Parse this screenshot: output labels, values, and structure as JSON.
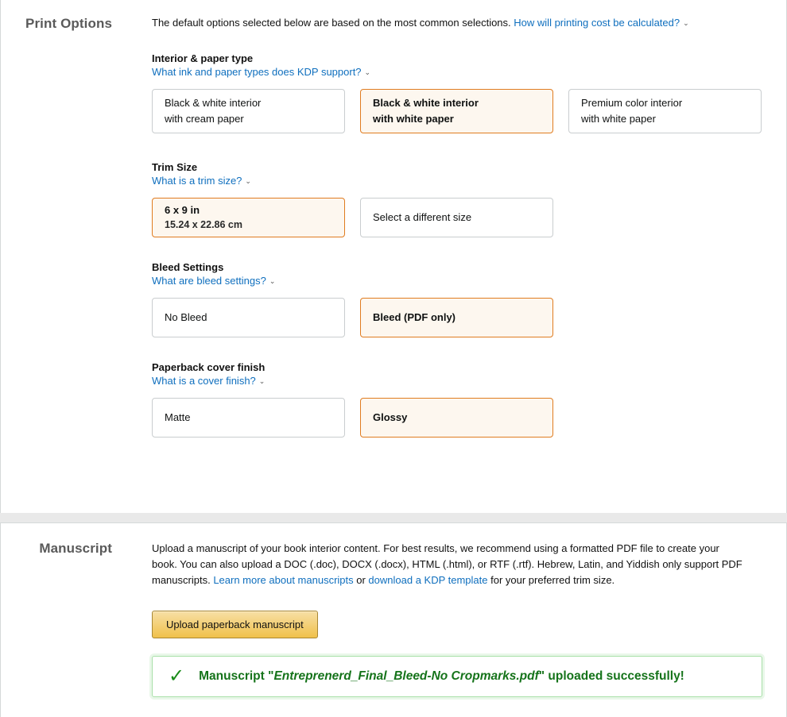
{
  "print_options": {
    "section_title": "Print Options",
    "intro_text": "The default options selected below are based on the most common selections.",
    "intro_link": "How will printing cost be calculated?",
    "groups": [
      {
        "label": "Interior & paper type",
        "help_link": "What ink and paper types does KDP support?",
        "options": [
          {
            "line1": "Black & white interior",
            "line2": "with cream paper",
            "selected": false
          },
          {
            "line1": "Black & white interior",
            "line2": "with white paper",
            "selected": true
          },
          {
            "line1": "Premium color interior",
            "line2": "with white paper",
            "selected": false
          }
        ]
      },
      {
        "label": "Trim Size",
        "help_link": "What is a trim size?",
        "options": [
          {
            "line1": "6 x 9 in",
            "line2": "15.24 x 22.86 cm",
            "selected": true
          },
          {
            "line1": "Select a different size",
            "line2": "",
            "selected": false
          }
        ]
      },
      {
        "label": "Bleed Settings",
        "help_link": "What are bleed settings?",
        "options": [
          {
            "line1": "No Bleed",
            "line2": "",
            "selected": false
          },
          {
            "line1": "Bleed (PDF only)",
            "line2": "",
            "selected": true
          }
        ]
      },
      {
        "label": "Paperback cover finish",
        "help_link": "What is a cover finish?",
        "options": [
          {
            "line1": "Matte",
            "line2": "",
            "selected": false
          },
          {
            "line1": "Glossy",
            "line2": "",
            "selected": true
          }
        ]
      }
    ]
  },
  "manuscript": {
    "section_title": "Manuscript",
    "desc_part1": "Upload a manuscript of your book interior content. For best results, we recommend using a formatted PDF file to create your book. You can also upload a DOC (.doc), DOCX (.docx), HTML (.html), or RTF (.rtf). Hebrew, Latin, and Yiddish only support PDF manuscripts. ",
    "link1": "Learn more about manuscripts",
    "desc_mid": " or ",
    "link2": "download a KDP template",
    "desc_part2": " for your preferred trim size.",
    "upload_button": "Upload paperback manuscript",
    "success": {
      "icon": "check-icon",
      "prefix": "Manuscript \"",
      "filename": "Entreprenerd_Final_Bleed-No Cropmarks.pdf",
      "suffix": "\" uploaded successfully!"
    }
  },
  "icons": {
    "chevron_down": "ˇ"
  },
  "colors": {
    "accent_orange": "#e07c20",
    "selected_bg": "#fdf7ef",
    "link_blue": "#0f6fbe",
    "success_green": "#15731a",
    "button_gold": "#f0c14b"
  }
}
